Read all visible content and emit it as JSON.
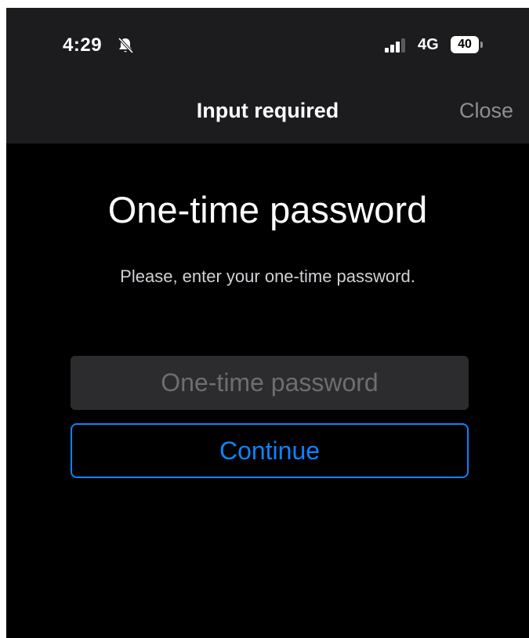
{
  "status_bar": {
    "time": "4:29",
    "network": "4G",
    "battery": "40",
    "icons": [
      "bell-slash-icon",
      "signal-icon",
      "battery-icon"
    ]
  },
  "nav": {
    "title": "Input required",
    "close_label": "Close"
  },
  "main": {
    "heading": "One-time password",
    "instruction": "Please, enter your one-time password.",
    "otp_field": {
      "value": "",
      "placeholder": "One-time password"
    },
    "continue_label": "Continue"
  },
  "colors": {
    "background": "#000000",
    "nav_background": "#1c1c1e",
    "accent": "#0a84ff",
    "input_background": "#2c2c2e",
    "secondary_text": "#8e8e93"
  }
}
